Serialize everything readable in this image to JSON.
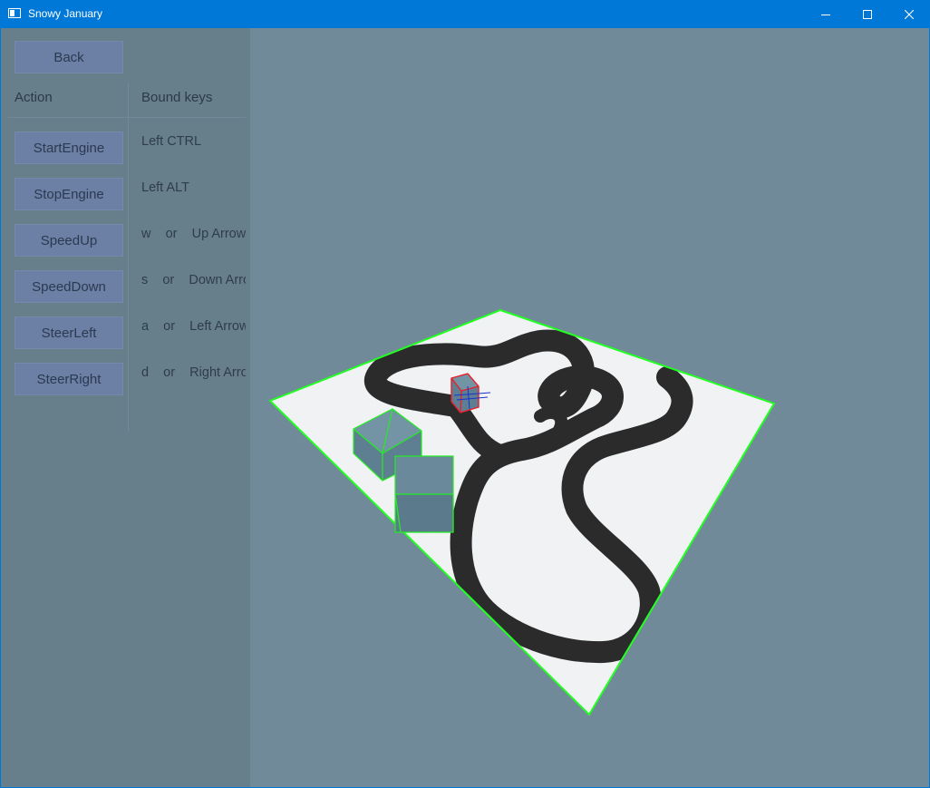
{
  "window": {
    "title": "Snowy January",
    "accent_color": "#0078d7",
    "controls": [
      "minimize-icon",
      "maximize-icon",
      "close-icon"
    ]
  },
  "panel": {
    "back_label": "Back",
    "headers": {
      "action": "Action",
      "bound_keys": "Bound keys"
    },
    "bindings": [
      {
        "action": "StartEngine",
        "keys": "Left CTRL"
      },
      {
        "action": "StopEngine",
        "keys": "Left ALT"
      },
      {
        "action": "SpeedUp",
        "keys": "w    or    Up Arrow"
      },
      {
        "action": "SpeedDown",
        "keys": "s    or    Down Arrow"
      },
      {
        "action": "SteerLeft",
        "keys": "a    or    Left Arrow"
      },
      {
        "action": "SteerRight",
        "keys": "d    or    Right Arrow"
      }
    ]
  },
  "scene": {
    "background_color": "#708a99",
    "ground_color": "#f1f3f4",
    "track_color": "#2b2b2c",
    "outline_color": "#22ff22",
    "box_color": "#5e7f91",
    "car_outline_color": "#e8202a"
  }
}
